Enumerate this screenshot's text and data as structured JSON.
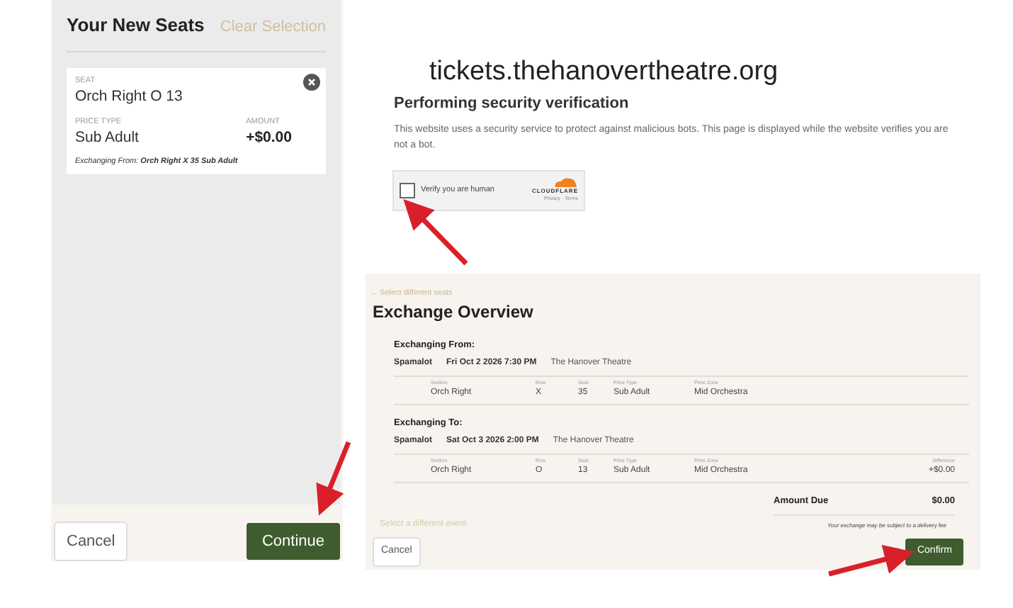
{
  "seat_panel": {
    "title": "Your New Seats",
    "clear_link": "Clear Selection",
    "card": {
      "seat_label": "SEAT",
      "seat": "Orch Right O 13",
      "price_type_label": "PRICE TYPE",
      "price_type": "Sub Adult",
      "amount_label": "AMOUNT",
      "amount": "+$0.00",
      "exchanging_from": "Exchanging From: **Orch Right X 35 Sub Adult**"
    },
    "buttons": [
      {
        "label": "Cancel",
        "kind": "secondary"
      },
      {
        "label": "Continue",
        "kind": "primary"
      }
    ]
  },
  "verification": {
    "domain": "tickets.thehanovertheatre.org",
    "heading": "Performing security verification",
    "message": "This website uses a security service to protect against malicious bots. This page is displayed while the website verifies you are not a bot.",
    "checkbox": {
      "label": "Verify you are human",
      "checked": false
    },
    "brand": "CLOUDFLARE",
    "brand_links": "Privacy · Terms"
  },
  "exchange": {
    "back_link": "← Select different seats",
    "title": "Exchange Overview",
    "sections": [
      {
        "heading": "Exchanging From:",
        "show": "Spamalot",
        "date": "Fri Oct 2 2026 7:30 PM",
        "venue": "The Hanover Theatre",
        "columns": [
          "Section",
          "Row",
          "Seat",
          "Price Type",
          "Price Zone"
        ],
        "row": [
          "Orch Right",
          "X",
          "35",
          "Sub Adult",
          "Mid Orchestra"
        ]
      },
      {
        "heading": "Exchanging To:",
        "show": "Spamalot",
        "date": "Sat Oct 3 2026 2:00 PM",
        "venue": "The Hanover Theatre",
        "columns": [
          "Section",
          "Row",
          "Seat",
          "Price Type",
          "Price Zone",
          "Difference"
        ],
        "row": [
          "Orch Right",
          "O",
          "13",
          "Sub Adult",
          "Mid Orchestra",
          "+$0.00"
        ]
      }
    ],
    "amount_due_label": "Amount Due",
    "amount_due": "$0.00",
    "note": "Your exchange may be subject to a delivery fee",
    "select_event_link": "Select a different event",
    "buttons": [
      {
        "label": "Cancel",
        "kind": "secondary"
      },
      {
        "label": "Confirm",
        "kind": "primary"
      }
    ]
  }
}
